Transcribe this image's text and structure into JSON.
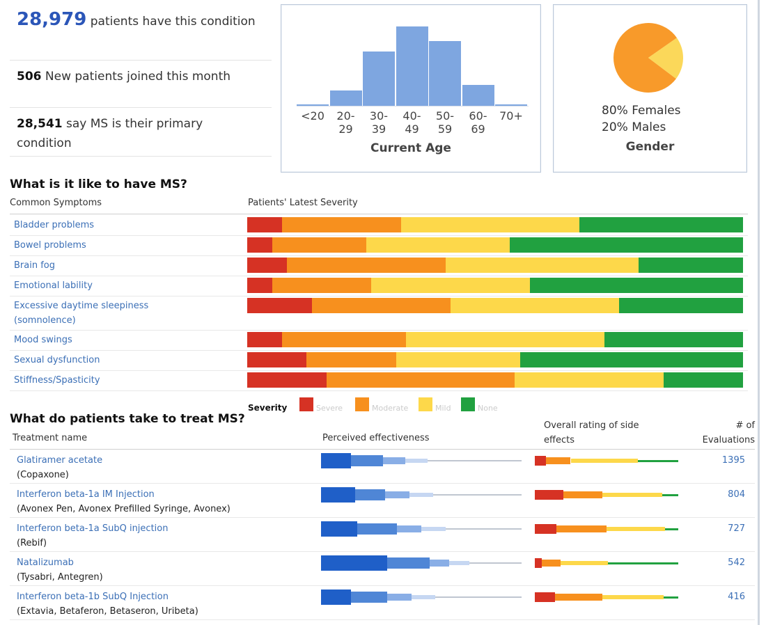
{
  "summary": {
    "patients_count": "28,979",
    "patients_text": "patients have this condition",
    "new_count": "506",
    "new_text": "New patients joined this month",
    "primary_count": "28,541",
    "primary_text": "say MS is their primary condition"
  },
  "age_chart": {
    "caption": "Current Age",
    "chart_data": {
      "type": "bar",
      "categories": [
        "<20",
        "20-29",
        "30-39",
        "40-49",
        "50-59",
        "60-69",
        "70+"
      ],
      "tick_lines": [
        [
          "<20",
          ""
        ],
        [
          "20-",
          "29"
        ],
        [
          "30-",
          "39"
        ],
        [
          "40-",
          "49"
        ],
        [
          "50-",
          "59"
        ],
        [
          "60-",
          "69"
        ],
        [
          "70+",
          ""
        ]
      ],
      "values": [
        1,
        19,
        68,
        100,
        82,
        26,
        2
      ],
      "title": "Current Age",
      "color": "#7ea6e0"
    }
  },
  "gender_chart": {
    "caption": "Gender",
    "females_label": "80% Females",
    "males_label": "20% Males",
    "chart_data": {
      "type": "pie",
      "labels": [
        "Females",
        "Males"
      ],
      "values": [
        80,
        20
      ],
      "colors": [
        "#f89a2a",
        "#fbd85a"
      ]
    }
  },
  "symptoms": {
    "heading": "What is it like to have MS?",
    "col_symptoms": "Common Symptoms",
    "col_severity": "Patients' Latest Severity",
    "legend_title": "Severity",
    "legend": [
      {
        "label": "Severe",
        "color": "#d63224"
      },
      {
        "label": "Moderate",
        "color": "#f7901e"
      },
      {
        "label": "Mild",
        "color": "#fdd84a"
      },
      {
        "label": "None",
        "color": "#21a140"
      }
    ],
    "chart_data": {
      "type": "bar",
      "stacked": true,
      "orientation": "horizontal",
      "categories": [
        "Bladder problems",
        "Bowel problems",
        "Brain fog",
        "Emotional lability",
        "Excessive daytime sleepiness (somnolence)",
        "Mood swings",
        "Sexual dysfunction",
        "Stiffness/Spasticity"
      ],
      "series": [
        {
          "name": "Severe",
          "values": [
            7,
            5,
            8,
            5,
            13,
            7,
            12,
            16
          ]
        },
        {
          "name": "Moderate",
          "values": [
            24,
            19,
            32,
            20,
            28,
            25,
            18,
            38
          ]
        },
        {
          "name": "Mild",
          "values": [
            36,
            29,
            39,
            32,
            34,
            40,
            25,
            30
          ]
        },
        {
          "name": "None",
          "values": [
            33,
            47,
            21,
            43,
            25,
            28,
            45,
            16
          ]
        }
      ]
    },
    "rows": [
      {
        "label": "Bladder problems"
      },
      {
        "label": "Bowel problems"
      },
      {
        "label": "Brain fog"
      },
      {
        "label": "Emotional lability"
      },
      {
        "label": "Excessive daytime sleepiness",
        "label2": "(somnolence)"
      },
      {
        "label": "Mood swings"
      },
      {
        "label": "Sexual dysfunction"
      },
      {
        "label": "Stiffness/Spasticity"
      }
    ]
  },
  "treatments": {
    "heading": "What do patients take to treat MS?",
    "col_name": "Treatment name",
    "col_effect": "Perceived effectiveness",
    "col_side_1": "Overall rating of side",
    "col_side_2": "effects",
    "col_count_1": "# of",
    "col_count_2": "Evaluations",
    "rows": [
      {
        "name": "Glatiramer acetate",
        "brand": "(Copaxone)",
        "count": "1395",
        "effectiveness": [
          15,
          16,
          11,
          11,
          47
        ],
        "side_effects": [
          8,
          17,
          47,
          28
        ]
      },
      {
        "name": "Interferon beta-1a IM Injection",
        "brand": "(Avonex Pen, Avonex Prefilled Syringe, Avonex)",
        "count": "804",
        "effectiveness": [
          17,
          15,
          12,
          12,
          44
        ],
        "side_effects": [
          20,
          27,
          42,
          11
        ]
      },
      {
        "name": "Interferon beta-1a SubQ injection",
        "brand": "(Rebif)",
        "count": "727",
        "effectiveness": [
          18,
          20,
          12,
          12,
          38
        ],
        "side_effects": [
          15,
          35,
          41,
          9
        ]
      },
      {
        "name": "Natalizumab",
        "brand": "(Tysabri, Antegren)",
        "count": "542",
        "effectiveness": [
          33,
          21,
          10,
          10,
          26
        ],
        "side_effects": [
          5,
          13,
          33,
          49
        ]
      },
      {
        "name": "Interferon beta-1b SubQ Injection",
        "brand": "(Extavia, Betaferon, Betaseron, Uribeta)",
        "count": "416",
        "effectiveness": [
          15,
          18,
          12,
          12,
          43
        ],
        "side_effects": [
          14,
          33,
          43,
          10
        ]
      }
    ]
  }
}
